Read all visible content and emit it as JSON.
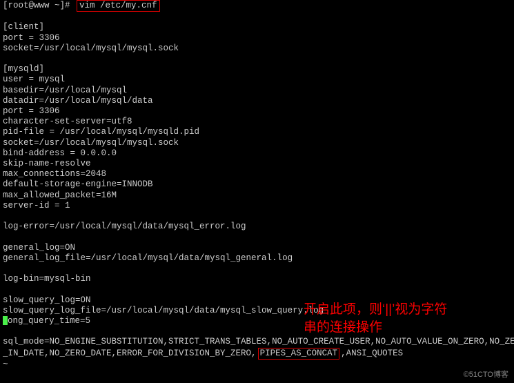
{
  "prompt": "[root@www ~]# ",
  "command": "vim /etc/my.cnf",
  "blank": " ",
  "client_section": "[client]",
  "client_port": "port = 3306",
  "client_socket": "socket=/usr/local/mysql/mysql.sock",
  "mysqld_section": "[mysqld]",
  "user": "user = mysql",
  "basedir": "basedir=/usr/local/mysql",
  "datadir": "datadir=/usr/local/mysql/data",
  "port": "port = 3306",
  "charset": "character-set-server=utf8",
  "pidfile": "pid-file = /usr/local/mysql/mysqld.pid",
  "socket": "socket=/usr/local/mysql/mysql.sock",
  "bind": "bind-address = 0.0.0.0",
  "skipname": "skip-name-resolve",
  "maxconn": "max_connections=2048",
  "engine": "default-storage-engine=INNODB",
  "packet": "max_allowed_packet=16M",
  "serverid": "server-id = 1",
  "logerror": "log-error=/usr/local/mysql/data/mysql_error.log",
  "genlog": "general_log=ON",
  "genlogfile": "general_log_file=/usr/local/mysql/data/mysql_general.log",
  "logbin": "log-bin=mysql-bin",
  "slowlog": "slow_query_log=ON",
  "slowlogfile": "slow_query_log_file=/usr/local/mysql/data/mysql_slow_query.log",
  "longquery_rest": "ong_query_time=5",
  "sqlmode_a": "sql_mode=NO_ENGINE_SUBSTITUTION,STRICT_TRANS_TABLES,NO_AUTO_CREATE_USER,NO_AUTO_VALUE_ON_ZERO,NO_ZERO",
  "sqlmode_b1": "_IN_DATE,NO_ZERO_DATE,ERROR_FOR_DIVISION_BY_ZERO,",
  "sqlmode_b2": "PIPES_AS_CONCAT",
  "sqlmode_b3": ",ANSI_QUOTES",
  "tilde": "~",
  "annotation_line1": "开启此项，则‘||’视为字符",
  "annotation_line2": "串的连接操作",
  "watermark": "©51CTO博客"
}
